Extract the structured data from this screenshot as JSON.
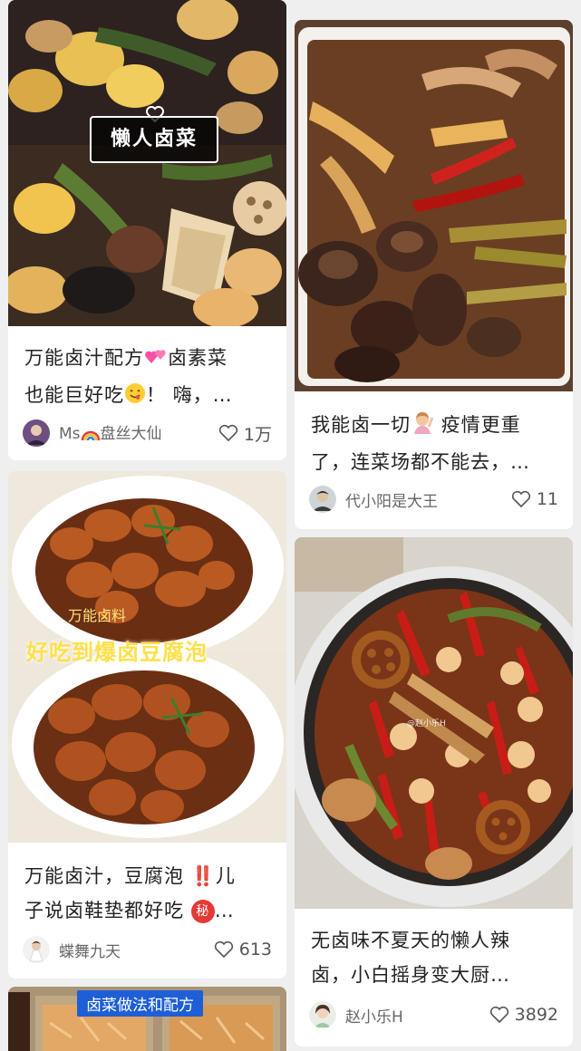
{
  "feed": {
    "cards": [
      {
        "image_label": "懒人卤菜",
        "title_line1": "万能卤汁配方",
        "title_line1_b": "卤素菜",
        "title_line2": "也能巨好吃",
        "title_line2_b": "！ 嗨，…",
        "author": "Ms",
        "author_b": "盘丝大仙",
        "likes": "1万"
      },
      {
        "title_line1": "我能卤一切",
        "title_line1_b": " 疫情更重",
        "title_line2": "了，连菜场都不能去，…",
        "author": "代小阳是大王",
        "likes": "11"
      },
      {
        "image_label_1": "万能卤料",
        "image_label_2": "好吃到爆卤豆腐泡",
        "title_line1": "万能卤汁，豆腐泡 ",
        "title_line1_b": "儿",
        "title_line2": "子说卤鞋垫都好吃 ",
        "title_line2_b": "…",
        "secret_badge": "秘",
        "double_exclaim": "‼️",
        "author": "蝶舞九天",
        "likes": "613"
      },
      {
        "watermark": "@赵小乐H",
        "title_line1": "无卤味不夏天的懒人辣",
        "title_line2": "卤，小白摇身变大厨…",
        "author": "赵小乐H",
        "likes": "3892"
      },
      {
        "image_label": "卤菜做法和配方"
      }
    ]
  },
  "colors": {
    "background": "#efefef",
    "card": "#ffffff",
    "text": "#222222",
    "muted": "#666666",
    "badge_blue": "#1e5fd8",
    "secret_red": "#e53935"
  },
  "icons": [
    "heart-outline-icon",
    "two-hearts-emoji",
    "yum-face-emoji",
    "raising-hand-emoji",
    "rainbow-emoji",
    "double-exclamation-emoji",
    "secret-emoji"
  ]
}
